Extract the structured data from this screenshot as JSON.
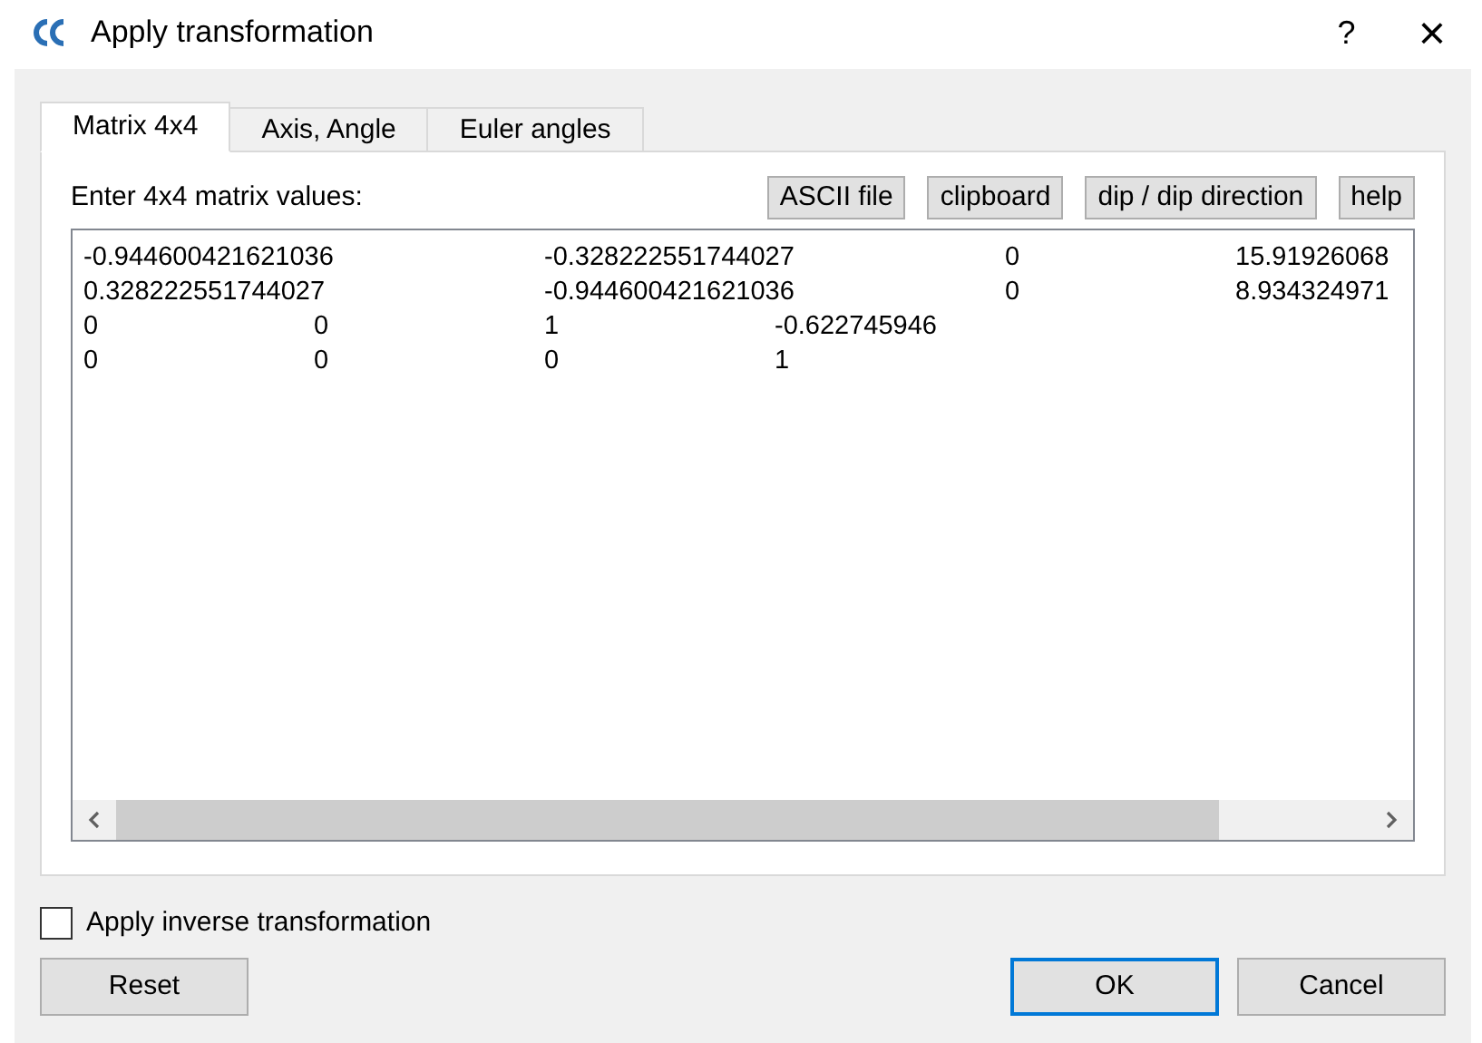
{
  "window": {
    "title": "Apply transformation",
    "help": "?",
    "close": "×"
  },
  "tabs": [
    {
      "label": "Matrix 4x4",
      "selected": true
    },
    {
      "label": "Axis, Angle",
      "selected": false
    },
    {
      "label": "Euler angles",
      "selected": false
    }
  ],
  "prompt": "Enter 4x4 matrix values:",
  "tool_buttons": [
    "ASCII file",
    "clipboard",
    "dip / dip direction",
    "help"
  ],
  "matrix_lines": [
    "-0.944600421621036\t-0.328222551744027\t0\t15.91926068",
    "0.328222551744027\t-0.944600421621036\t0\t8.934324971",
    "0\t0\t1\t-0.622745946",
    "0\t0\t0\t1"
  ],
  "inverse": {
    "label": "Apply inverse transformation",
    "checked": false
  },
  "buttons": [
    {
      "label": "Reset",
      "kind": "left",
      "default": false
    },
    {
      "label": "OK",
      "kind": "right",
      "default": true
    },
    {
      "label": "Cancel",
      "kind": "right",
      "default": false
    }
  ]
}
